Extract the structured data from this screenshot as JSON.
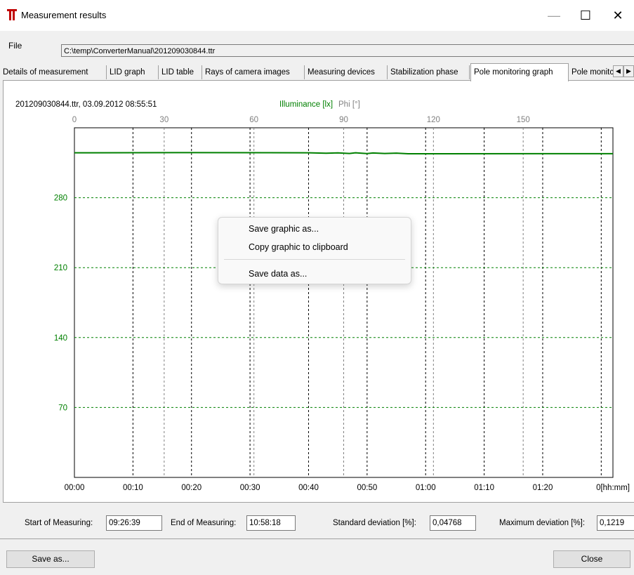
{
  "window": {
    "title": "Measurement results",
    "min_glyph": "—",
    "max_glyph": "☐",
    "close_glyph": "✕",
    "icon_name": "app-logo-icon",
    "accent_color": "#c00000"
  },
  "file": {
    "label": "File",
    "path": "C:\\temp\\ConverterManual\\201209030844.ttr"
  },
  "tabs": [
    {
      "label": "Details of measurement"
    },
    {
      "label": "LID graph"
    },
    {
      "label": "LID table"
    },
    {
      "label": "Rays of camera images"
    },
    {
      "label": "Measuring devices"
    },
    {
      "label": "Stabilization phase"
    },
    {
      "label": "Pole monitoring graph",
      "active": true
    },
    {
      "label": "Pole monitc"
    }
  ],
  "tab_scroll": {
    "left": "◀",
    "right": "▶"
  },
  "graph": {
    "header": "201209030844.ttr, 03.09.2012 08:55:51",
    "legend_illuminance": "Illuminance [lx]",
    "legend_phi": "Phi [°]",
    "illuminance_color": "#008000",
    "phi_color": "#808080"
  },
  "chart_data": {
    "type": "line",
    "x_label": "[hh:mm]",
    "x_ticks": [
      "00:00",
      "00:10",
      "00:20",
      "00:30",
      "00:40",
      "00:50",
      "01:00",
      "01:10",
      "01:20",
      "0"
    ],
    "phi_ticks": [
      "0",
      "30",
      "60",
      "90",
      "120",
      "150"
    ],
    "y_ticks": [
      "280",
      "210",
      "140",
      "70"
    ],
    "ylim": [
      0,
      350
    ],
    "xlim": [
      "00:00",
      "01:32"
    ],
    "phi_lim": [
      0,
      180
    ],
    "series": [
      {
        "name": "Illuminance [lx]",
        "color": "#008000",
        "x": [
          "00:00",
          "00:20",
          "00:40",
          "00:43",
          "00:45",
          "00:47",
          "00:48",
          "00:50",
          "00:51",
          "00:53",
          "00:55",
          "00:57",
          "01:00",
          "01:20",
          "01:32"
        ],
        "y": [
          325,
          325.1,
          325,
          324.5,
          324.9,
          324.3,
          325,
          324.2,
          324.8,
          324.3,
          324.6,
          324.0,
          324.0,
          324.1,
          324.1
        ]
      }
    ],
    "grid": true
  },
  "context_menu": {
    "items": [
      "Save graphic as...",
      "Copy graphic to clipboard",
      "Save data as..."
    ]
  },
  "stats": {
    "start_label": "Start of Measuring:",
    "start_value": "09:26:39",
    "end_label": "End of Measuring:",
    "end_value": "10:58:18",
    "std_label": "Standard deviation [%]:",
    "std_value": "0,04768",
    "max_label": "Maximum deviation [%]:",
    "max_value": "0,1219"
  },
  "buttons": {
    "save_as": "Save as...",
    "close": "Close"
  }
}
